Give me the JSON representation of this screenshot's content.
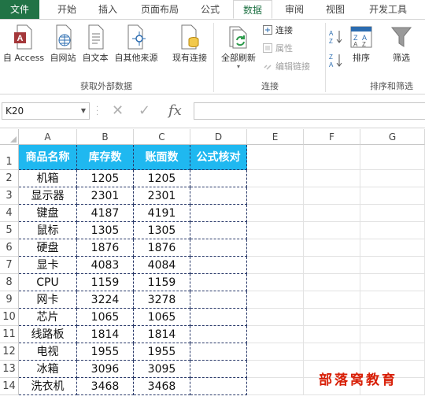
{
  "ribbon_tabs": [
    "文件",
    "开始",
    "插入",
    "页面布局",
    "公式",
    "数据",
    "审阅",
    "视图",
    "开发工具"
  ],
  "ribbon": {
    "get_external": {
      "buttons": [
        "自 Access",
        "自网站",
        "自文本",
        "自其他来源",
        "现有连接"
      ],
      "label": "获取外部数据"
    },
    "connections": {
      "refresh_all": "全部刷新",
      "connections": "连接",
      "properties": "属性",
      "edit_links": "编辑链接",
      "label": "连接"
    },
    "sort_filter": {
      "sort": "排序",
      "filter": "筛选",
      "label": "排序和筛选"
    }
  },
  "formula_bar": {
    "name_box": "K20",
    "fx": "fx",
    "formula": ""
  },
  "columns": [
    "A",
    "B",
    "C",
    "D",
    "E",
    "F",
    "G"
  ],
  "rows": [
    "1",
    "2",
    "3",
    "4",
    "5",
    "6",
    "7",
    "8",
    "9",
    "10",
    "11",
    "12",
    "13",
    "14"
  ],
  "table": {
    "headers": [
      "商品名称",
      "库存数",
      "账面数",
      "公式核对"
    ],
    "data": [
      [
        "机箱",
        "1205",
        "1205",
        ""
      ],
      [
        "显示器",
        "2301",
        "2301",
        ""
      ],
      [
        "键盘",
        "4187",
        "4191",
        ""
      ],
      [
        "鼠标",
        "1305",
        "1305",
        ""
      ],
      [
        "硬盘",
        "1876",
        "1876",
        ""
      ],
      [
        "显卡",
        "4083",
        "4084",
        ""
      ],
      [
        "CPU",
        "1159",
        "1159",
        ""
      ],
      [
        "网卡",
        "3224",
        "3278",
        ""
      ],
      [
        "芯片",
        "1065",
        "1065",
        ""
      ],
      [
        "线路板",
        "1814",
        "1814",
        ""
      ],
      [
        "电视",
        "1955",
        "1955",
        ""
      ],
      [
        "冰箱",
        "3096",
        "3095",
        ""
      ],
      [
        "洗衣机",
        "3468",
        "3468",
        ""
      ]
    ]
  },
  "watermark": "部落窝教育",
  "colors": {
    "file_tab": "#217346",
    "header_fill": "#1fb8f0",
    "watermark": "#d81e06"
  }
}
